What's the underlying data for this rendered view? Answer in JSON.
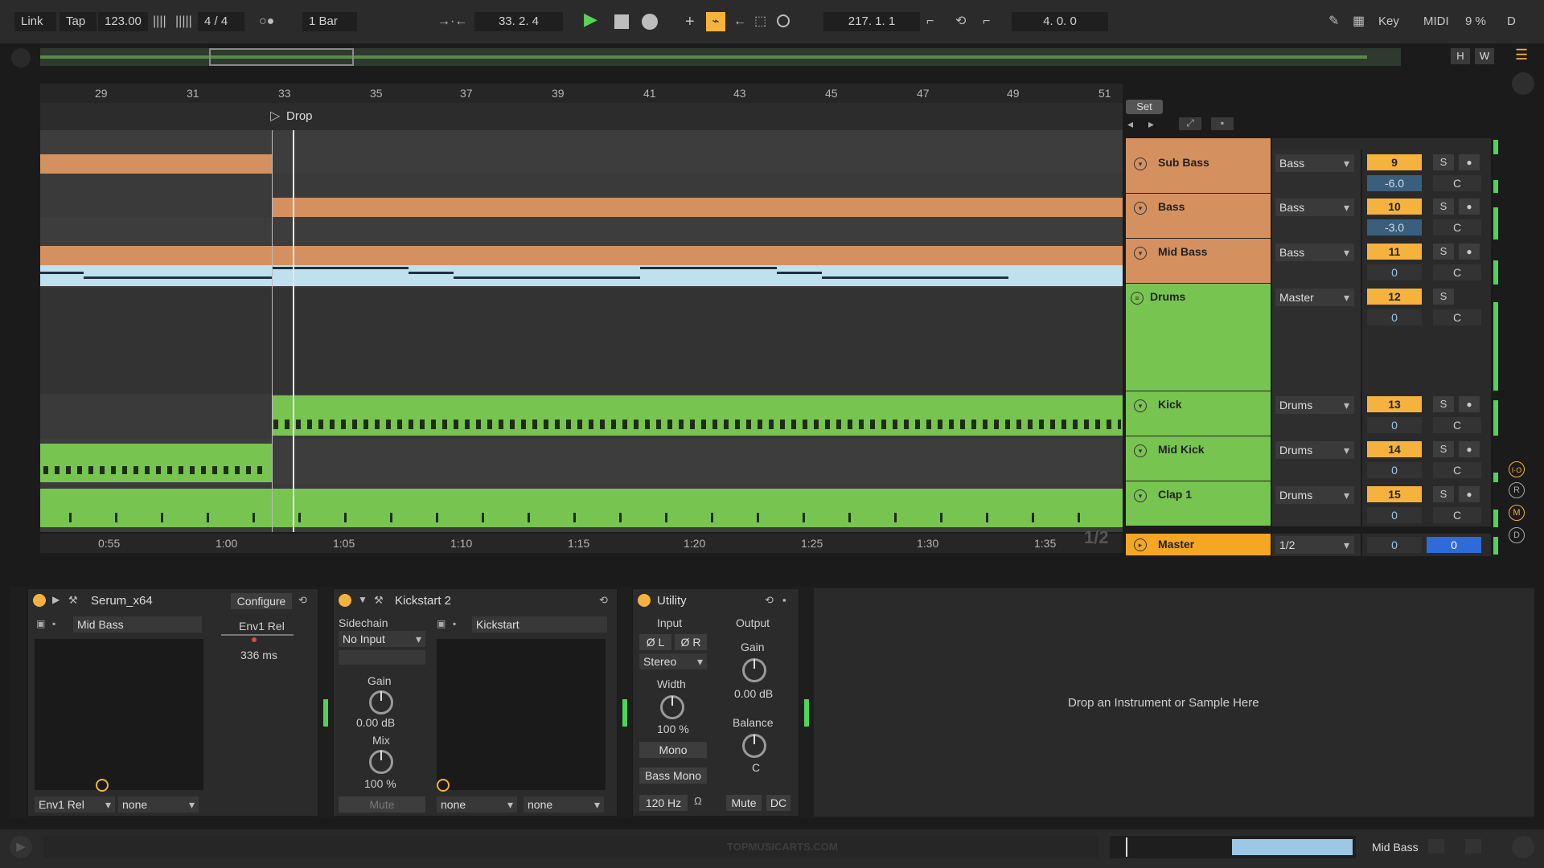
{
  "transport": {
    "link": "Link",
    "tap": "Tap",
    "tempo": "123.00",
    "signature": "4 / 4",
    "quantize": "1 Bar",
    "position": "33.  2.  4",
    "loop_start": "217.  1.  1",
    "loop_length": "4.  0.  0",
    "key": "Key",
    "midi": "MIDI",
    "cpu": "9 %",
    "d": "D"
  },
  "overview": {
    "h": "H",
    "w": "W"
  },
  "ruler": {
    "bars": [
      "29",
      "31",
      "33",
      "35",
      "37",
      "39",
      "41",
      "43",
      "45",
      "47",
      "49",
      "51"
    ]
  },
  "locator": {
    "label": "Drop"
  },
  "time_ruler": {
    "times": [
      "0:55",
      "1:00",
      "1:05",
      "1:10",
      "1:15",
      "1:20",
      "1:25",
      "1:30",
      "1:35"
    ],
    "page": "1/2"
  },
  "set_label": "Set",
  "tracks": [
    {
      "name": "Sub Bass",
      "input": "Bass",
      "number": "9",
      "volume": "-6.0",
      "pan": "C",
      "color": "#d4915f"
    },
    {
      "name": "Bass",
      "input": "Bass",
      "number": "10",
      "volume": "-3.0",
      "pan": "C",
      "color": "#d4915f"
    },
    {
      "name": "Mid Bass",
      "input": "Bass",
      "number": "11",
      "volume": "0",
      "pan": "C",
      "color": "#d4915f"
    },
    {
      "name": "Drums",
      "input": "Master",
      "number": "12",
      "volume": "0",
      "pan": "C",
      "color": "#78c451"
    },
    {
      "name": "Kick",
      "input": "Drums",
      "number": "13",
      "volume": "0",
      "pan": "C",
      "color": "#78c451"
    },
    {
      "name": "Mid Kick",
      "input": "Drums",
      "number": "14",
      "volume": "0",
      "pan": "C",
      "color": "#78c451"
    },
    {
      "name": "Clap 1",
      "input": "Drums",
      "number": "15",
      "volume": "0",
      "pan": "C",
      "color": "#78c451"
    }
  ],
  "master": {
    "name": "Master",
    "output": "1/2",
    "volume": "0",
    "pan": "0",
    "color": "#f5a623"
  },
  "devices": {
    "serum": {
      "title": "Serum_x64",
      "configure": "Configure",
      "param": "Mid Bass",
      "env_label": "Env1 Rel",
      "env_value": "336 ms",
      "sel1": "Env1 Rel",
      "sel2": "none"
    },
    "kickstart": {
      "title": "Kickstart 2",
      "sidechain": "Sidechain",
      "input": "No Input",
      "gain_label": "Gain",
      "gain_value": "0.00 dB",
      "mix_label": "Mix",
      "mix_value": "100 %",
      "mute": "Mute",
      "param": "Kickstart",
      "sel1": "none",
      "sel2": "none"
    },
    "utility": {
      "title": "Utility",
      "input": "Input",
      "output": "Output",
      "phase_l": "Ø L",
      "phase_r": "Ø R",
      "mode": "Stereo",
      "width_label": "Width",
      "width_value": "100 %",
      "mono": "Mono",
      "bass_mono": "Bass Mono",
      "freq": "120 Hz",
      "gain_label": "Gain",
      "gain_value": "0.00 dB",
      "balance_label": "Balance",
      "balance_value": "C",
      "mute": "Mute",
      "dc": "DC"
    },
    "drop_hint": "Drop an Instrument or Sample Here"
  },
  "status": {
    "watermark": "TOPMUSICARTS.COM",
    "selected_track": "Mid Bass"
  }
}
